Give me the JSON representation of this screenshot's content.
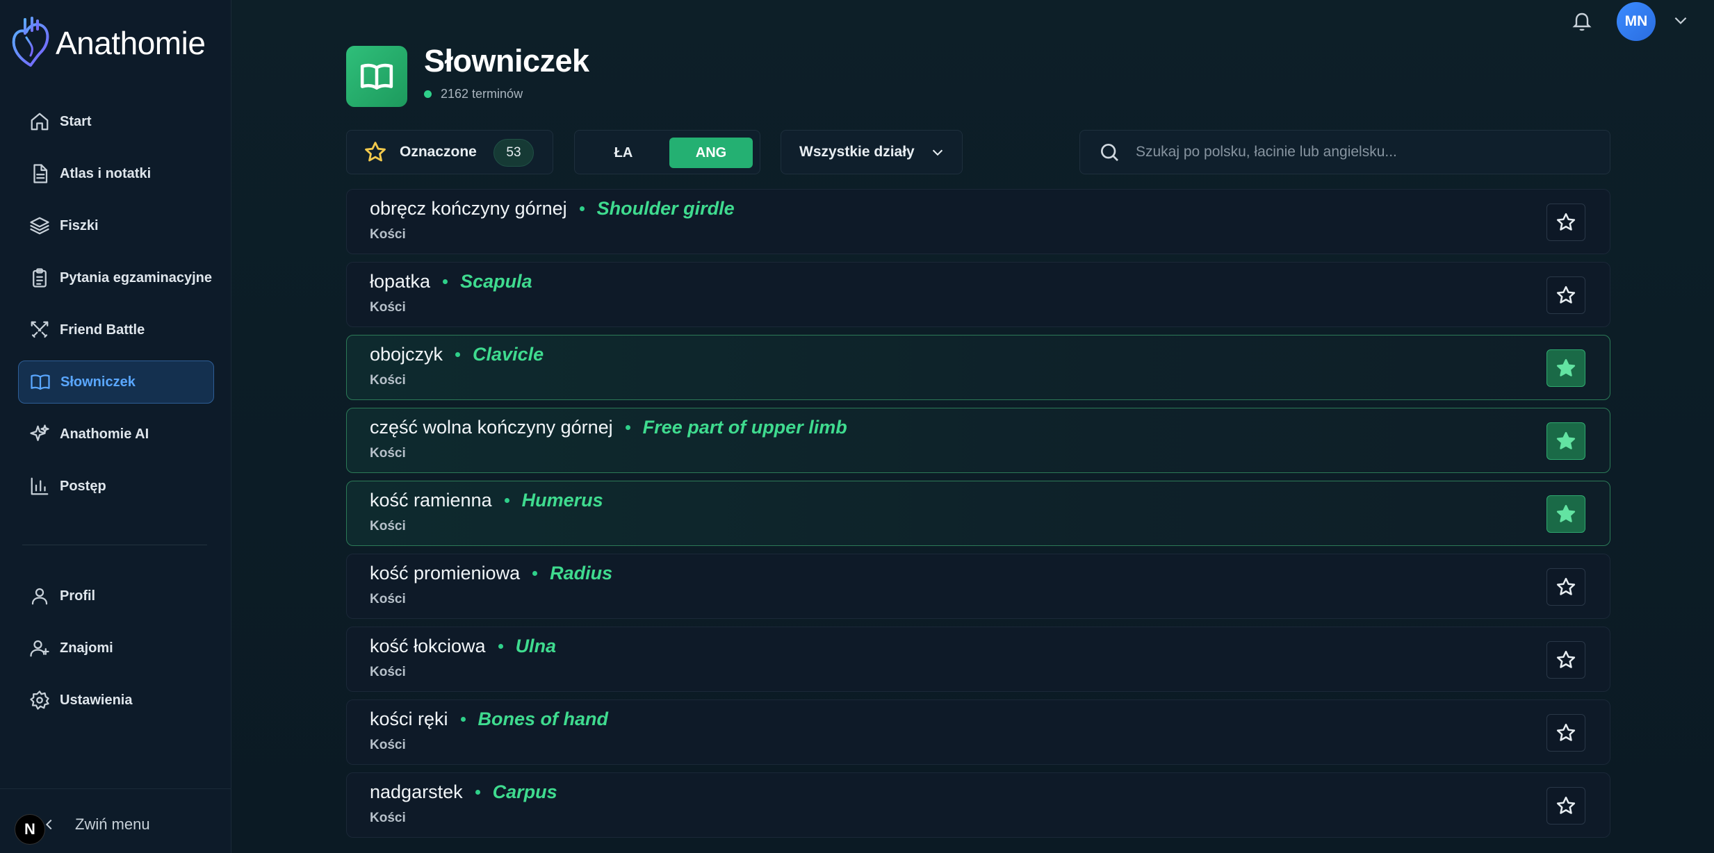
{
  "app": {
    "name": "Anathomie"
  },
  "sidebar": {
    "items": [
      {
        "label": "Start",
        "icon": "home-icon"
      },
      {
        "label": "Atlas i notatki",
        "icon": "document-icon"
      },
      {
        "label": "Fiszki",
        "icon": "layers-icon"
      },
      {
        "label": "Pytania egzaminacyjne",
        "icon": "clipboard-icon"
      },
      {
        "label": "Friend Battle",
        "icon": "swords-icon"
      },
      {
        "label": "Słowniczek",
        "icon": "book-icon",
        "active": true
      },
      {
        "label": "Anathomie AI",
        "icon": "sparkles-icon"
      },
      {
        "label": "Postęp",
        "icon": "chart-icon"
      }
    ],
    "secondary": [
      {
        "label": "Profil",
        "icon": "user-icon"
      },
      {
        "label": "Znajomi",
        "icon": "user-plus-icon"
      },
      {
        "label": "Ustawienia",
        "icon": "gear-icon"
      }
    ],
    "collapse_label": "Zwiń menu",
    "badge": "N"
  },
  "topbar": {
    "avatar_initials": "MN"
  },
  "page": {
    "title": "Słowniczek",
    "term_count": "2162 terminów"
  },
  "filters": {
    "marked_label": "Oznaczone",
    "marked_count": "53",
    "lang_la": "ŁA",
    "lang_ang": "ANG",
    "lang_selected": "ANG",
    "department": "Wszystkie działy",
    "search_placeholder": "Szukaj po polsku, łacinie lub angielsku..."
  },
  "terms": [
    {
      "pl": "obręcz kończyny górnej",
      "en": "Shoulder girdle",
      "category": "Kości",
      "marked": false
    },
    {
      "pl": "łopatka",
      "en": "Scapula",
      "category": "Kości",
      "marked": false
    },
    {
      "pl": "obojczyk",
      "en": "Clavicle",
      "category": "Kości",
      "marked": true
    },
    {
      "pl": "część wolna kończyny górnej",
      "en": "Free part of upper limb",
      "category": "Kości",
      "marked": true
    },
    {
      "pl": "kość ramienna",
      "en": "Humerus",
      "category": "Kości",
      "marked": true
    },
    {
      "pl": "kość promieniowa",
      "en": "Radius",
      "category": "Kości",
      "marked": false
    },
    {
      "pl": "kość łokciowa",
      "en": "Ulna",
      "category": "Kości",
      "marked": false
    },
    {
      "pl": "kości ręki",
      "en": "Bones of hand",
      "category": "Kości",
      "marked": false
    },
    {
      "pl": "nadgarstek",
      "en": "Carpus",
      "category": "Kości",
      "marked": false
    }
  ],
  "colors": {
    "accent_green": "#24b072",
    "term_english": "#3fdb8f",
    "active_nav": "#5aa7ff",
    "star_marked": "#63e3a2",
    "star_filter": "#f2c94c"
  }
}
